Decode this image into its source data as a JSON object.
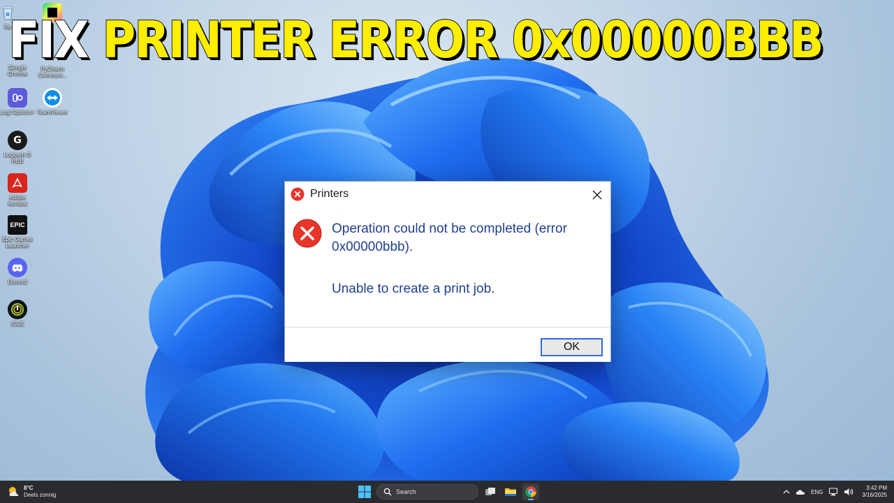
{
  "headline": {
    "word1": "FIX",
    "word2": "PRINTER ERROR 0x00000BBB"
  },
  "colors": {
    "headline_white": "#ffffff",
    "headline_yellow": "#ffee00",
    "dialog_text": "#203f8f",
    "error_red": "#e8352a",
    "ok_focus_border": "#2c6fd1",
    "taskbar_bg": "#2a2b2f"
  },
  "desktop_icons": [
    {
      "label": "Re",
      "icon": "recycle-bin-icon"
    },
    {
      "label": "Google Chrome",
      "icon": "chrome-icon"
    },
    {
      "label": "PyCharm Communi...",
      "icon": "pycharm-icon"
    },
    {
      "label": "Logi Options+",
      "icon": "logi-options-icon"
    },
    {
      "label": "TeamViewer",
      "icon": "teamviewer-icon"
    },
    {
      "label": "Logitech G HUB",
      "icon": "logitech-g-hub-icon"
    },
    {
      "label": "Adobe Acrobat",
      "icon": "acrobat-icon"
    },
    {
      "label": "Epic Games Launcher",
      "icon": "epic-games-icon",
      "glyph": "EPIC"
    },
    {
      "label": "Discord",
      "icon": "discord-icon"
    },
    {
      "label": "iCUE",
      "icon": "icue-icon"
    }
  ],
  "dialog": {
    "title": "Printers",
    "message": "Operation could not be completed (error 0x00000bbb).",
    "detail": "Unable to create a print job.",
    "ok_label": "OK"
  },
  "taskbar": {
    "weather": {
      "temperature": "8°C",
      "description": "Deels zonnig",
      "icon": "partly-sunny-icon"
    },
    "search_label": "Search",
    "apps": [
      {
        "name": "task-view",
        "icon": "task-view-icon"
      },
      {
        "name": "file-explorer",
        "icon": "folder-icon"
      },
      {
        "name": "chrome",
        "icon": "chrome-icon",
        "active": true
      }
    ],
    "tray": {
      "language": "ENG",
      "time": "3:42 PM",
      "date": "3/16/2025"
    }
  }
}
